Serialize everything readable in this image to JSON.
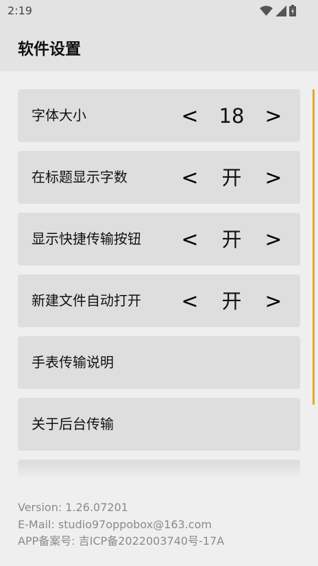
{
  "status_bar": {
    "time": "2:19"
  },
  "app_bar": {
    "title": "软件设置"
  },
  "settings": [
    {
      "label": "字体大小",
      "prev": "<",
      "value": "18",
      "next": ">"
    },
    {
      "label": "在标题显示字数",
      "prev": "<",
      "value": "开",
      "next": ">"
    },
    {
      "label": "显示快捷传输按钮",
      "prev": "<",
      "value": "开",
      "next": ">"
    },
    {
      "label": "新建文件自动打开",
      "prev": "<",
      "value": "开",
      "next": ">"
    },
    {
      "label": "手表传输说明"
    },
    {
      "label": "关于后台传输"
    }
  ],
  "footer": {
    "version": "Version: 1.26.07201",
    "email": "E-Mail: studio97oppobox@163.com",
    "icp": "APP备案号: 吉ICP备2022003740号-17A"
  },
  "colors": {
    "scroll_accent": "#e8a52c",
    "row_bg": "#dedede",
    "header_bg": "#e3e3e3"
  }
}
